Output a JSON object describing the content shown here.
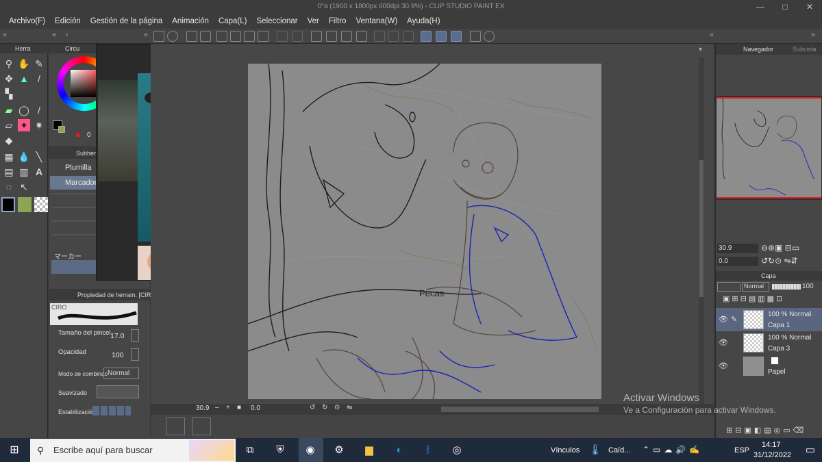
{
  "window": {
    "title": "0°a (1900 x 1800px 600dpi 30.9%) - CLIP STUDIO PAINT EX",
    "controls": [
      "—",
      "□",
      "✕"
    ]
  },
  "menu": [
    "Archivo(F)",
    "Edición",
    "Gestión de la página",
    "Animación",
    "Capa(L)",
    "Seleccionar",
    "Ver",
    "Filtro",
    "Ventana(W)",
    "Ayuda(H)"
  ],
  "panels": {
    "tool_tab": "Herra",
    "color_tab": "Circu",
    "color_value": "0",
    "subtool_tab": "Subher",
    "subtools": [
      "Plumilla",
      "Marcador"
    ],
    "brush_caption": "マーカー",
    "toolprop_title": "Propiedad de herram. [CIRO",
    "brush_name": "CIRO",
    "brush_size_label": "Tamaño del pincel",
    "brush_size_value": "17.0",
    "opacity_label": "Opacidad",
    "opacity_value": "100",
    "blend_label": "Modo de combinac",
    "blend_value": "Normal",
    "smooth_label": "Suavizado",
    "stab_label": "Estabilización"
  },
  "navigator": {
    "tab": "Navegador",
    "tab2": "Subvista",
    "zoom": "30.9",
    "rotation": "0.0"
  },
  "layers": {
    "tab": "Capa",
    "blend": "Normal",
    "opacity": "100",
    "items": [
      {
        "mode": "100 % Normal",
        "name": "Capa 1"
      },
      {
        "mode": "100 % Normal",
        "name": "Capa 3"
      },
      {
        "mode": "",
        "name": "Papel"
      }
    ]
  },
  "status": {
    "zoom": "30.9",
    "angle": "0.0"
  },
  "watermark": {
    "line1": "Activar Windows",
    "line2": "Ve a Configuración para activar Windows."
  },
  "taskbar": {
    "search_placeholder": "Escribe aquí para buscar",
    "links": "Vínculos",
    "weather": "Caíd...",
    "lang": "ESP",
    "time": "14:17",
    "date": "31/12/2022"
  },
  "sketch_text": "Pecas"
}
